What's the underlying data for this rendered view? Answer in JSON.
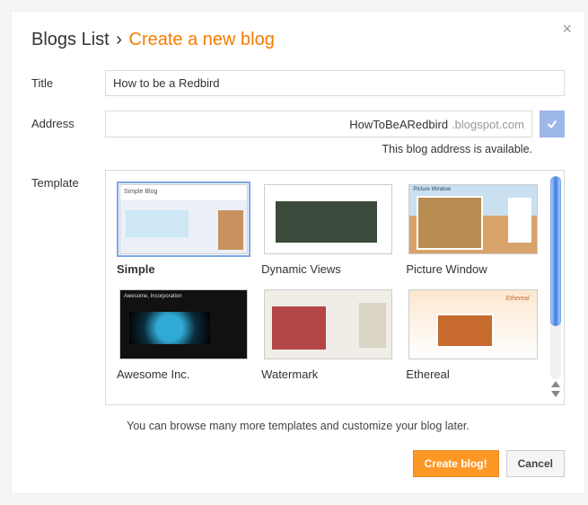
{
  "header": {
    "breadcrumb_root": "Blogs List",
    "chevron": "›",
    "breadcrumb_current": "Create a new blog"
  },
  "labels": {
    "title": "Title",
    "address": "Address",
    "template": "Template"
  },
  "title_field": {
    "value": "How to be a Redbird"
  },
  "address_field": {
    "value": "HowToBeARedbird",
    "suffix": ".blogspot.com",
    "availability_msg": "This blog address is available."
  },
  "templates": [
    {
      "name": "Simple",
      "selected": true,
      "thumb_class": "t-simple",
      "mini": "Simple Blog"
    },
    {
      "name": "Dynamic Views",
      "selected": false,
      "thumb_class": "t-dynamic",
      "mini": ""
    },
    {
      "name": "Picture Window",
      "selected": false,
      "thumb_class": "t-picture",
      "mini": "Picture Window"
    },
    {
      "name": "Awesome Inc.",
      "selected": false,
      "thumb_class": "t-awesome",
      "mini": "Awesome, Incorporation"
    },
    {
      "name": "Watermark",
      "selected": false,
      "thumb_class": "t-water",
      "mini": ""
    },
    {
      "name": "Ethereal",
      "selected": false,
      "thumb_class": "t-ethereal",
      "mini": "Ethereal"
    }
  ],
  "hint": "You can browse many more templates and customize your blog later.",
  "buttons": {
    "create": "Create blog!",
    "cancel": "Cancel"
  }
}
